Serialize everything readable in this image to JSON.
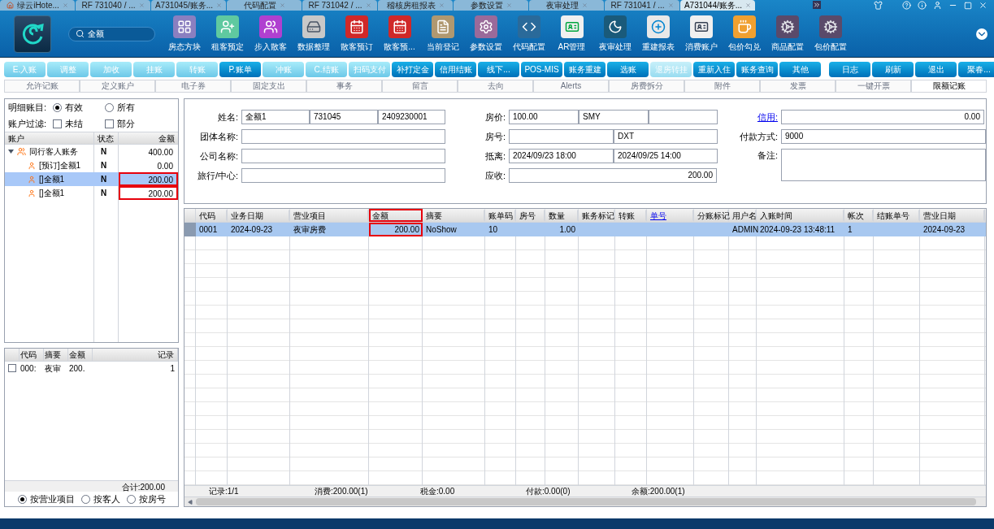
{
  "tabs": [
    {
      "label": "绿云iHote...",
      "selected": false,
      "home": true
    },
    {
      "label": "RF 731040 / ...",
      "selected": false
    },
    {
      "label": "A731045/账务...",
      "selected": false
    },
    {
      "label": "代码配置",
      "selected": false
    },
    {
      "label": "RF 731042 / ...",
      "selected": false
    },
    {
      "label": "稽核房租报表",
      "selected": false
    },
    {
      "label": "参数设置",
      "selected": false
    },
    {
      "label": "夜审处理",
      "selected": false
    },
    {
      "label": "RF 731041 / ...",
      "selected": false
    },
    {
      "label": "A731044/账务...",
      "selected": true
    }
  ],
  "search": {
    "value": "全额"
  },
  "toolbar": [
    "房态方块",
    "租客预定",
    "步入散客",
    "数据整理",
    "散客预订",
    "散客预...",
    "当前登记",
    "参数设置",
    "代码配置",
    "AR管理",
    "夜审处理",
    "重建报表",
    "消费账户",
    "包价勾兑",
    "商品配置",
    "包价配置"
  ],
  "actions": [
    {
      "label": "E.入账",
      "kind": "light"
    },
    {
      "label": "调整",
      "kind": "light"
    },
    {
      "label": "加收",
      "kind": "light"
    },
    {
      "label": "挂账",
      "kind": "light"
    },
    {
      "label": "转账",
      "kind": "light"
    },
    {
      "label": "P.账单",
      "kind": "dark"
    },
    {
      "label": "冲账",
      "kind": "light"
    },
    {
      "label": "C.结账",
      "kind": "light"
    },
    {
      "label": "扫码支付",
      "kind": "light"
    },
    {
      "label": "补打定金",
      "kind": "dark"
    },
    {
      "label": "信用结账",
      "kind": "dark"
    },
    {
      "label": "线下...",
      "kind": "dark"
    },
    {
      "label": "POS-MIS",
      "kind": "dark"
    },
    {
      "label": "账务重建",
      "kind": "dark"
    },
    {
      "label": "选账",
      "kind": "dark"
    },
    {
      "label": "退房转挂",
      "kind": "disabled"
    },
    {
      "label": "重新入住",
      "kind": "dark"
    },
    {
      "label": "账务查询",
      "kind": "dark"
    },
    {
      "label": "其他",
      "kind": "dark"
    }
  ],
  "actions_right": [
    "日志",
    "刷新",
    "退出",
    "聚春..."
  ],
  "subtabs": [
    {
      "label": "允许记账",
      "selected": false
    },
    {
      "label": "定义账户",
      "selected": false
    },
    {
      "label": "电子券",
      "selected": false
    },
    {
      "label": "固定支出",
      "selected": false
    },
    {
      "label": "事务",
      "selected": false
    },
    {
      "label": "留言",
      "selected": false
    },
    {
      "label": "去向",
      "selected": false
    },
    {
      "label": "Alerts",
      "selected": false
    },
    {
      "label": "房费拆分",
      "selected": false
    },
    {
      "label": "附件",
      "selected": false
    },
    {
      "label": "发票",
      "selected": false
    },
    {
      "label": "一键开票",
      "selected": false
    },
    {
      "label": "限额记账",
      "selected": true
    }
  ],
  "filters": {
    "detail_label": "明细账目:",
    "detail_options": [
      {
        "label": "有效",
        "selected": true
      },
      {
        "label": "所有",
        "selected": false
      }
    ],
    "account_label": "账户过滤:",
    "account_options": [
      {
        "label": "未结",
        "checked": false
      },
      {
        "label": "部分",
        "checked": false
      }
    ]
  },
  "accounts": {
    "columns": [
      "账户",
      "状态",
      "金额"
    ],
    "rows": [
      {
        "name": "同行客人账务",
        "status": "N",
        "amount": "400.00",
        "expanded": true,
        "selected": false,
        "highlighted": false,
        "children": [
          {
            "name": "[预订]全额1",
            "status": "N",
            "amount": "0.00",
            "selected": false,
            "highlighted": false
          },
          {
            "name": "[]全额1",
            "status": "N",
            "amount": "200.00",
            "selected": true,
            "highlighted": true
          },
          {
            "name": "[]全额1",
            "status": "N",
            "amount": "200.00",
            "selected": false,
            "highlighted": true
          }
        ]
      }
    ]
  },
  "summary": {
    "columns": [
      "代码",
      "摘要",
      "金额",
      "记录"
    ],
    "rows": [
      {
        "checked": false,
        "cells": [
          "000:",
          "夜审",
          "200.",
          "1"
        ]
      }
    ],
    "total": "合计:200.00",
    "group_by": [
      {
        "label": "按营业项目",
        "selected": true
      },
      {
        "label": "按客人",
        "selected": false
      },
      {
        "label": "按房号",
        "selected": false
      }
    ]
  },
  "form": {
    "name_label": "姓名:",
    "name": [
      "全额1",
      "731045",
      "2409230001"
    ],
    "group_label": "团体名称:",
    "company_label": "公司名称:",
    "agent_label": "旅行/中心:",
    "rate_label": "房价:",
    "rate": [
      "100.00",
      "SMY"
    ],
    "room_label": "房号:",
    "room": [
      "DXT"
    ],
    "dates_label": "抵离:",
    "dates": [
      "2024/09/23 18:00",
      "2024/09/25 14:00"
    ],
    "due_label": "应收:",
    "due": "200.00",
    "credit_label": "信用:",
    "credit": "0.00",
    "payment_label": "付款方式:",
    "payment": "9000",
    "note_label": "备注:"
  },
  "transactions": {
    "columns": [
      {
        "label": "代码",
        "link": false,
        "highlighted": false
      },
      {
        "label": "业务日期",
        "link": false,
        "highlighted": false
      },
      {
        "label": "营业项目",
        "link": false,
        "highlighted": false
      },
      {
        "label": "金额",
        "link": false,
        "highlighted": true
      },
      {
        "label": "摘要",
        "link": false,
        "highlighted": false
      },
      {
        "label": "账单码",
        "link": false,
        "highlighted": false
      },
      {
        "label": "房号",
        "link": false,
        "highlighted": false
      },
      {
        "label": "数量",
        "link": false,
        "highlighted": false
      },
      {
        "label": "账务标记",
        "link": false,
        "highlighted": false
      },
      {
        "label": "转账",
        "link": false,
        "highlighted": false
      },
      {
        "label": "单号",
        "link": true,
        "highlighted": false
      },
      {
        "label": "分账标记",
        "link": false,
        "highlighted": false
      },
      {
        "label": "用户名",
        "link": false,
        "highlighted": false
      },
      {
        "label": "入账时间",
        "link": false,
        "highlighted": false
      },
      {
        "label": "帐次",
        "link": false,
        "highlighted": false
      },
      {
        "label": "结账单号",
        "link": false,
        "highlighted": false
      },
      {
        "label": "营业日期",
        "link": false,
        "highlighted": false
      }
    ],
    "rows": [
      {
        "selected": true,
        "cells": [
          "0001",
          "2024-09-23",
          "夜审房费",
          "200.00",
          "NoShow",
          "10",
          "",
          "1.00",
          "",
          "",
          "",
          "",
          "ADMIN",
          "2024-09-23 13:48:11",
          "1",
          "",
          "2024-09-23"
        ]
      }
    ]
  },
  "status_bar": [
    "记录:1/1",
    "消费:200.00(1)",
    "税金:0.00",
    "付款:0.00(0)",
    "余额:200.00(1)"
  ]
}
